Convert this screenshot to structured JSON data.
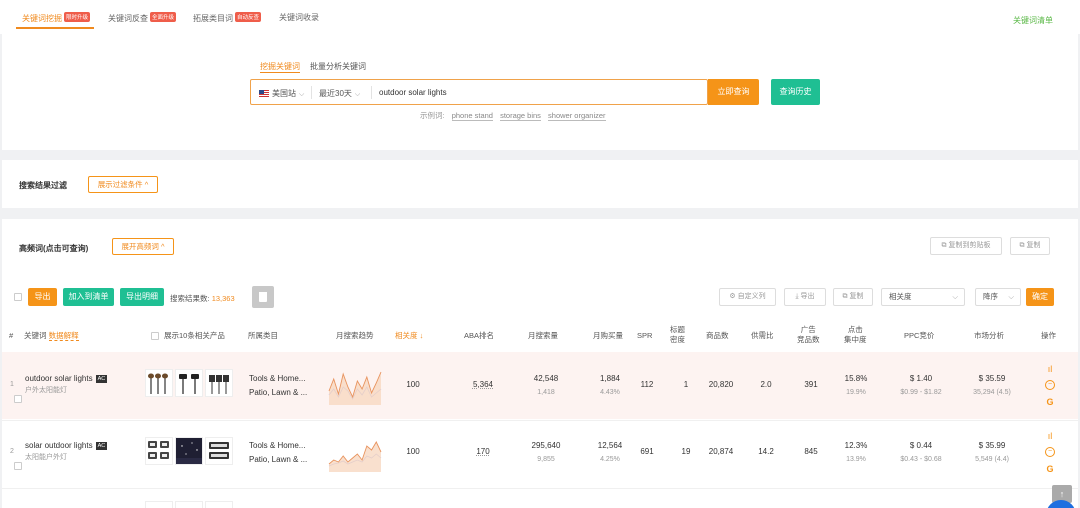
{
  "tabs": [
    {
      "label": "关键词挖掘",
      "tag": "限时升级"
    },
    {
      "label": "关键词反查",
      "tag": "全面升级"
    },
    {
      "label": "拓展类目词",
      "tag": "自动反查"
    },
    {
      "label": "关键词收录",
      "tag": ""
    }
  ],
  "keyword_list_link": "关键词清单",
  "search": {
    "tabs": [
      "挖掘关键词",
      "批量分析关键词"
    ],
    "site": "美国站",
    "period": "最近30天",
    "keyword": "outdoor solar lights",
    "query_button": "立即查询",
    "history_button": "查询历史",
    "examples_label": "示例词:",
    "examples": [
      "phone stand",
      "storage bins",
      "shower organizer"
    ]
  },
  "filter": {
    "label": "搜索结果过滤",
    "show_button": "展示过滤条件 ^"
  },
  "high_freq": {
    "label": "高频词(点击可查询)",
    "expand_button": "展开高频词 ^",
    "copy_clipboard": "复制到剪贴板",
    "copy": "复制"
  },
  "toolbar": {
    "export": "导出",
    "add_to_list": "加入到清单",
    "export_detail": "导出明细",
    "result_count_label": "搜索结果数:",
    "result_count": "13,363",
    "custom_columns": "自定义列",
    "export2": "导出",
    "copy2": "复制",
    "sort_field": "相关度",
    "sort_order": "降序",
    "confirm": "确定"
  },
  "columns": {
    "index": "#",
    "keyword": "关键词",
    "keyword_help": "数据解释",
    "top10": "展示10条相关产品",
    "category": "所属类目",
    "trend": "月搜索趋势",
    "relevance": "相关度",
    "aba": "ABA排名",
    "monthly_search": "月搜索量",
    "monthly_purchase": "月购买量",
    "spr": "SPR",
    "title_density_1": "标题",
    "title_density_2": "密度",
    "product_count": "商品数",
    "supply_demand": "供需比",
    "ad_1": "广告",
    "ad_2": "竞品数",
    "click_1": "点击",
    "click_2": "集中度",
    "ppc": "PPC竞价",
    "market": "市场分析",
    "action": "操作"
  },
  "rows": [
    {
      "index": "1",
      "keyword": "outdoor solar lights",
      "badge": "AC",
      "keyword_cn": "户外太阳能灯",
      "category_1": "Tools & Home...",
      "category_2": "Patio, Lawn & ...",
      "relevance": "100",
      "aba": "5,364",
      "monthly_search": "42,548",
      "monthly_search_sub": "1,418",
      "monthly_purchase": "1,884",
      "monthly_purchase_sub": "4.43%",
      "spr": "112",
      "title_density": "1",
      "product_count": "20,820",
      "supply_demand": "2.0",
      "ad_competitors": "391",
      "click_conc": "15.8%",
      "click_conc_sub": "19.9%",
      "ppc": "$ 1.40",
      "ppc_range": "$0.99 - $1.82",
      "market_price": "$ 35.59",
      "market_sub": "35,294 (4.5)",
      "trend": [
        22,
        10,
        25,
        5,
        18,
        28,
        12,
        20,
        8,
        24,
        14,
        3
      ],
      "trend2": [
        26,
        20,
        28,
        18,
        22,
        30,
        20,
        26,
        18,
        28,
        24,
        20
      ]
    },
    {
      "index": "2",
      "keyword": "solar outdoor lights",
      "badge": "AC",
      "keyword_cn": "太阳能户外灯",
      "category_1": "Tools & Home...",
      "category_2": "Patio, Lawn & ...",
      "relevance": "100",
      "aba": "170",
      "monthly_search": "295,640",
      "monthly_search_sub": "9,855",
      "monthly_purchase": "12,564",
      "monthly_purchase_sub": "4.25%",
      "spr": "691",
      "title_density": "19",
      "product_count": "20,874",
      "supply_demand": "14.2",
      "ad_competitors": "845",
      "click_conc": "12.3%",
      "click_conc_sub": "13.9%",
      "ppc": "$ 0.44",
      "ppc_range": "$0.43 - $0.68",
      "market_price": "$ 35.99",
      "market_sub": "5,549 (4.4)",
      "trend": [
        28,
        24,
        26,
        20,
        26,
        22,
        18,
        24,
        10,
        14,
        6,
        16
      ],
      "trend2": [
        30,
        28,
        27,
        25,
        28,
        26,
        24,
        26,
        20,
        22,
        18,
        22
      ]
    }
  ],
  "colors": {
    "accent": "#f59418",
    "green": "#1fbf93",
    "highlight_row": "#fdf3f1"
  }
}
